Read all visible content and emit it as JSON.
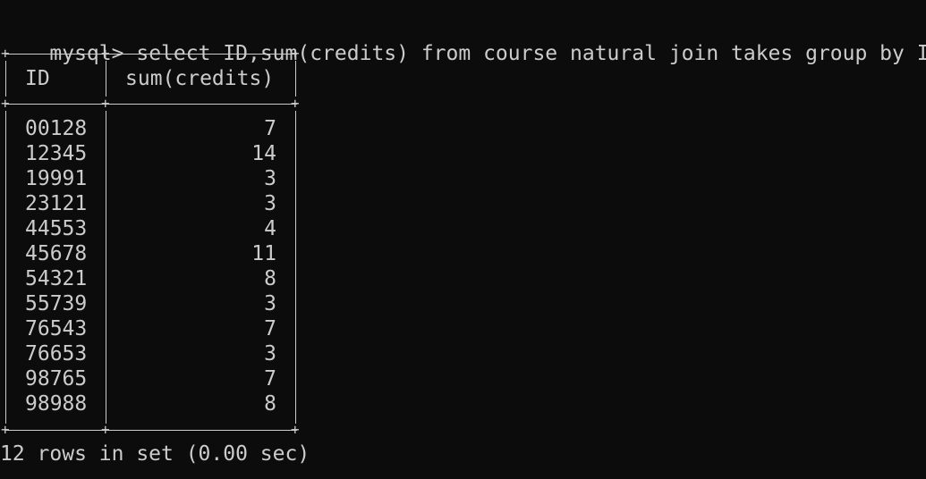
{
  "prompt": "mysql>",
  "command": "select ID,sum(credits) from course natural join takes group by ID;",
  "table": {
    "headers": [
      "ID",
      "sum(credits)"
    ],
    "rows": [
      [
        "00128",
        "7"
      ],
      [
        "12345",
        "14"
      ],
      [
        "19991",
        "3"
      ],
      [
        "23121",
        "3"
      ],
      [
        "44553",
        "4"
      ],
      [
        "45678",
        "11"
      ],
      [
        "54321",
        "8"
      ],
      [
        "55739",
        "3"
      ],
      [
        "76543",
        "7"
      ],
      [
        "76653",
        "3"
      ],
      [
        "98765",
        "7"
      ],
      [
        "98988",
        "8"
      ]
    ]
  },
  "status": "12 rows in set (0.00 sec)",
  "colors": {
    "background": "#0c0c0c",
    "text": "#cccccc"
  }
}
